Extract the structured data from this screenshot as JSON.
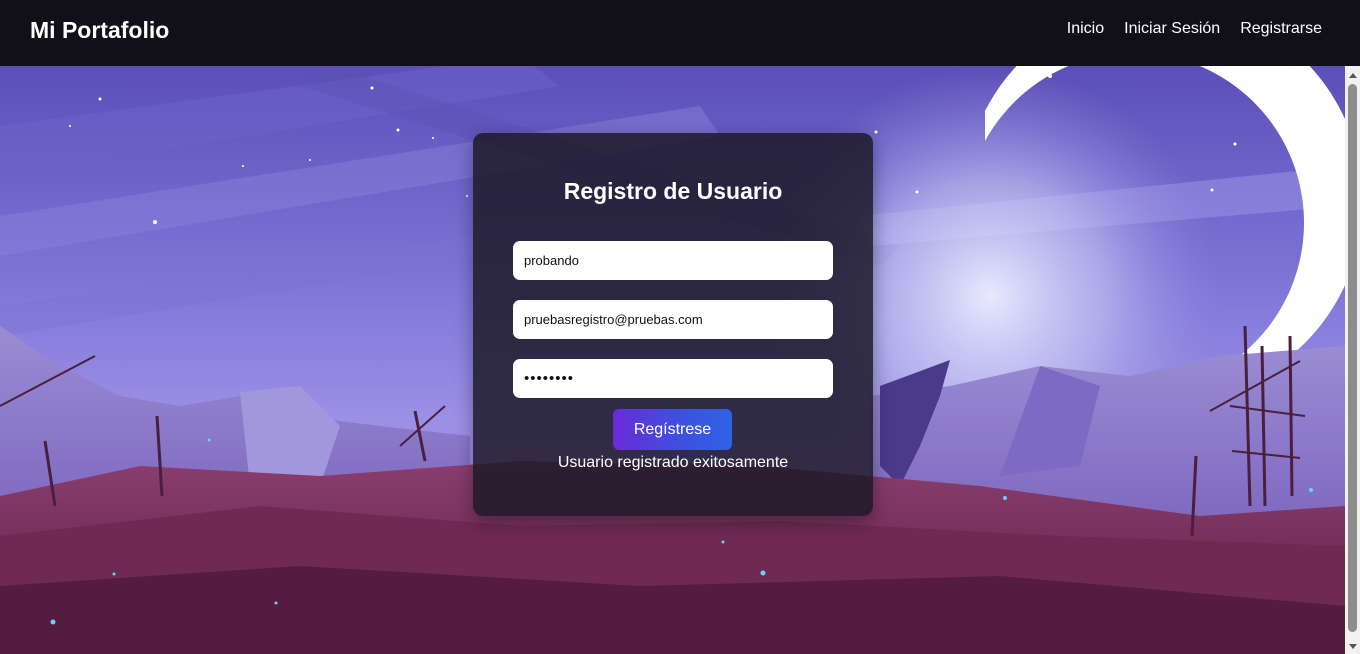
{
  "navbar": {
    "brand": "Mi Portafolio",
    "links": [
      "Inicio",
      "Iniciar Sesión",
      "Registrarse"
    ]
  },
  "form": {
    "title": "Registro de Usuario",
    "username_value": "probando",
    "email_value": "pruebasregistro@pruebas.com",
    "password_value": "••••••••",
    "submit_label": "Regístrese",
    "status_message": "Usuario registrado exitosamente"
  },
  "colors": {
    "navbar_bg": "#110f18",
    "card_bg": "rgba(28,24,38,0.84)",
    "button_start": "#6a2bd8",
    "button_end": "#2e62e6"
  }
}
